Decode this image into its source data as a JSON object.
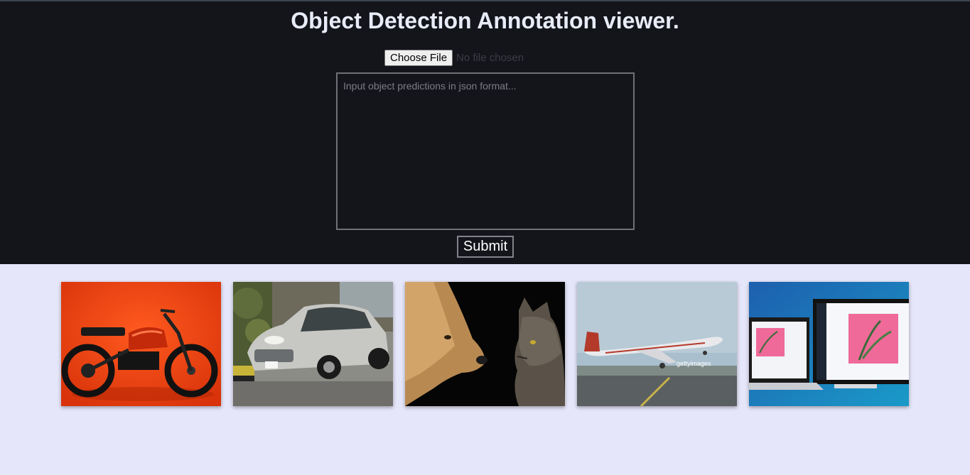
{
  "header": {
    "title": "Object Detection Annotation viewer."
  },
  "file_input": {
    "button_label": "Choose File",
    "status": "No file chosen"
  },
  "predictions": {
    "placeholder": "Input object predictions in json format...",
    "value": ""
  },
  "submit": {
    "label": "Submit"
  },
  "gallery": {
    "images": [
      {
        "name": "motorcycle-image"
      },
      {
        "name": "car-image"
      },
      {
        "name": "dog-and-cat-image"
      },
      {
        "name": "airplane-image",
        "watermark": "gettyimages"
      },
      {
        "name": "laptop-and-monitor-image"
      }
    ]
  },
  "colors": {
    "hero_background": "#14151b",
    "page_background": "#e6e6fa",
    "title_text": "#e8ecf8"
  }
}
